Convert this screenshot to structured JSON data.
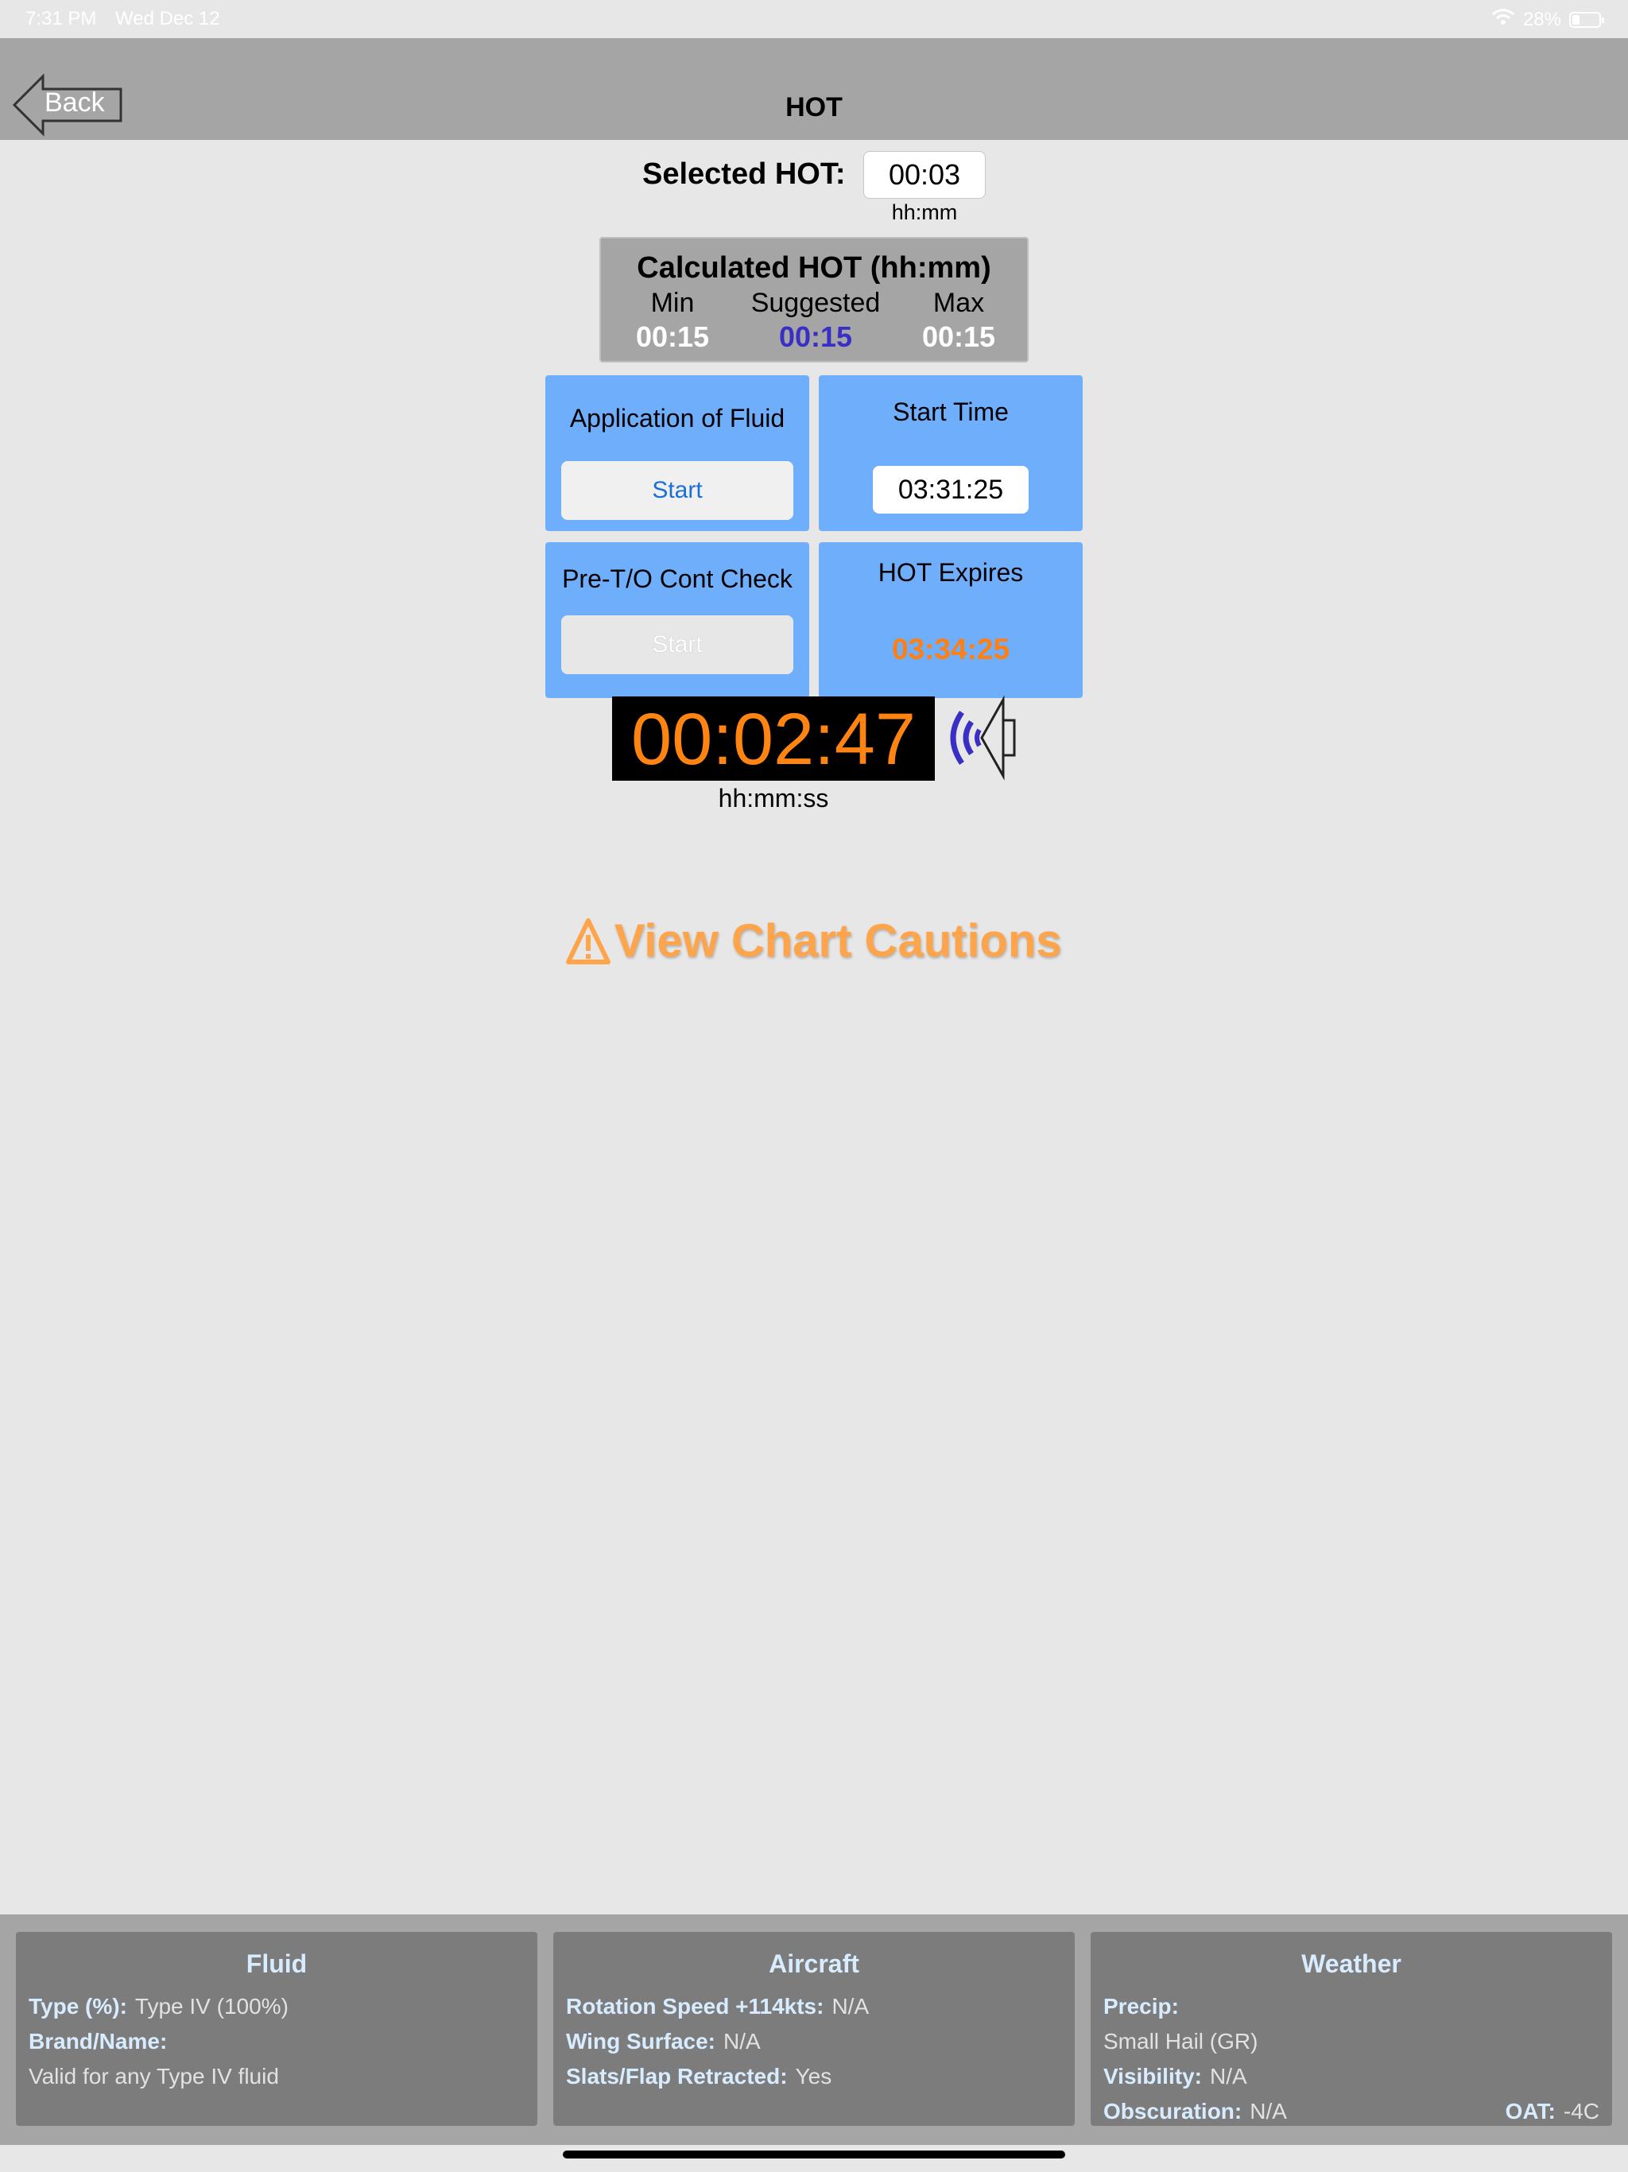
{
  "status_bar": {
    "time": "7:31 PM",
    "date": "Wed Dec 12",
    "battery": "28%",
    "battery_level": 0.28
  },
  "nav": {
    "back_label": "Back",
    "title": "HOT"
  },
  "selected_hot": {
    "label": "Selected HOT:",
    "value": "00:03",
    "unit": "hh:mm"
  },
  "calculated": {
    "title": "Calculated HOT (hh:mm)",
    "min_label": "Min",
    "min_value": "00:15",
    "suggested_label": "Suggested",
    "suggested_value": "00:15",
    "max_label": "Max",
    "max_value": "00:15"
  },
  "tiles": {
    "application": {
      "label": "Application of Fluid",
      "button": "Start"
    },
    "start_time": {
      "label": "Start Time",
      "value": "03:31:25"
    },
    "pre_to": {
      "label": "Pre-T/O Cont Check",
      "button": "Start"
    },
    "expires": {
      "label": "HOT Expires",
      "value": "03:34:25"
    }
  },
  "timer": {
    "value": "00:02:47",
    "unit": "hh:mm:ss"
  },
  "cautions": {
    "label": "View Chart Cautions"
  },
  "panels": {
    "fluid": {
      "title": "Fluid",
      "type_key": "Type (%):",
      "type_value": "Type IV (100%)",
      "brand_key": "Brand/Name:",
      "note": "Valid for any Type IV fluid"
    },
    "aircraft": {
      "title": "Aircraft",
      "rotation_key": "Rotation Speed +114kts:",
      "rotation_value": "N/A",
      "wing_key": "Wing Surface:",
      "wing_value": "N/A",
      "slats_key": "Slats/Flap Retracted:",
      "slats_value": "Yes"
    },
    "weather": {
      "title": "Weather",
      "precip_key": "Precip:",
      "precip_value": "Small Hail (GR)",
      "visibility_key": "Visibility:",
      "visibility_value": "N/A",
      "obscuration_key": "Obscuration:",
      "obscuration_value": "N/A",
      "oat_key": "OAT:",
      "oat_value": "-4C"
    }
  },
  "colors": {
    "nav_gray": "#a5a5a5",
    "tile_blue": "#6eaefb",
    "timer_orange": "#ff8411",
    "suggested_blue": "#3a2fc5",
    "caution_orange": "#fea44a",
    "panel_gray": "#7c7c7c"
  }
}
